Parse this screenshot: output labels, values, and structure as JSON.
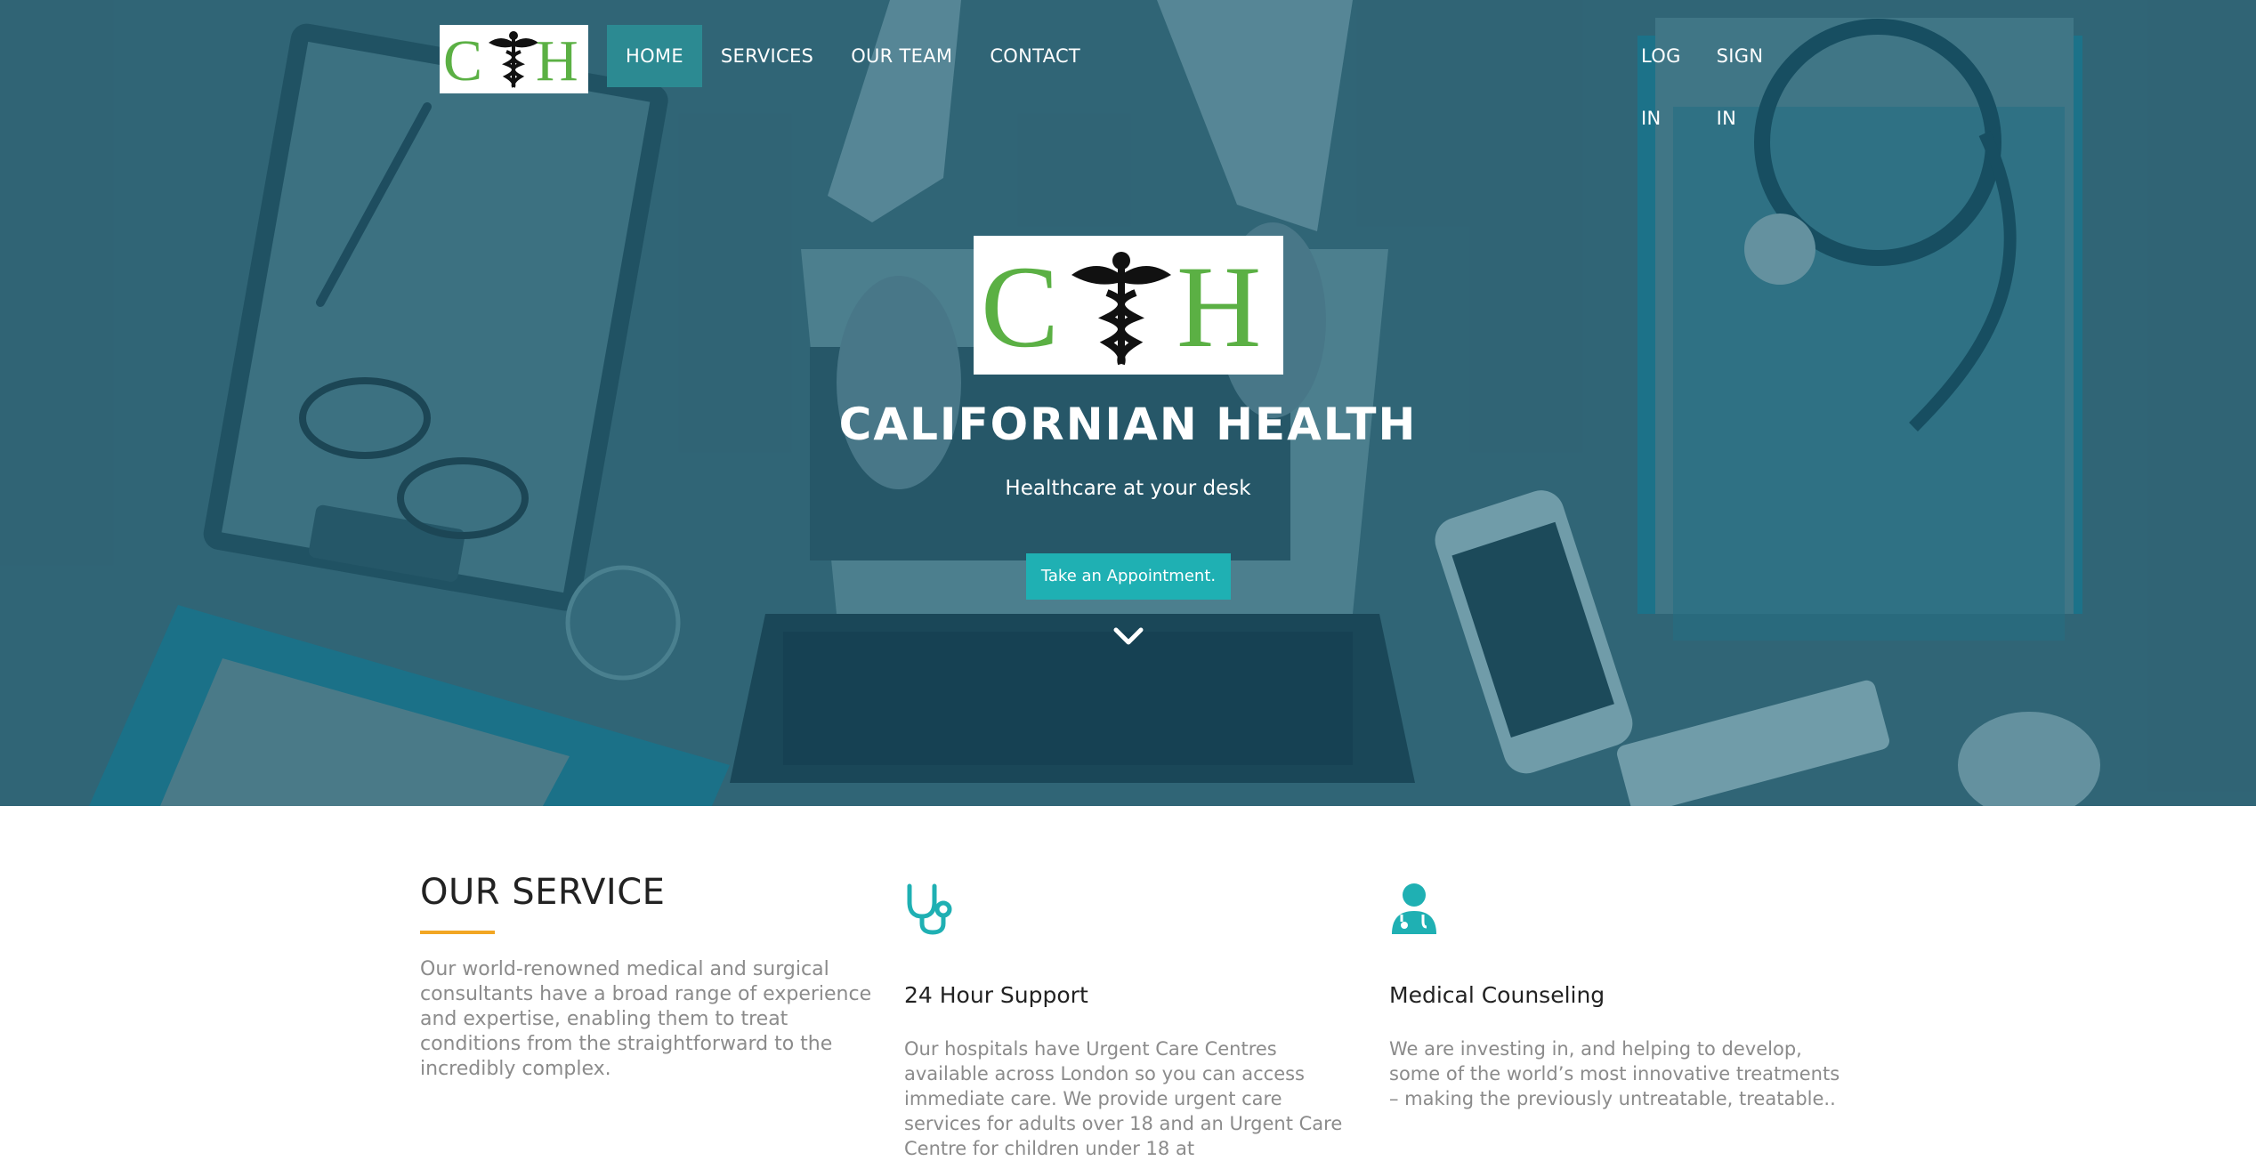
{
  "colors": {
    "accent": "#1fb0b3",
    "underline": "#f2a623",
    "nav_active": "#2c8a92",
    "logo_green": "#5bb044"
  },
  "nav": {
    "logo_letters": [
      "C",
      "H"
    ],
    "links": [
      "HOME",
      "SERVICES",
      "OUR TEAM",
      "CONTACT"
    ],
    "right_links": [
      "LOG IN",
      "SIGN IN"
    ]
  },
  "hero": {
    "logo_letters": [
      "C",
      "H"
    ],
    "title": "CALIFORNIAN HEALTH",
    "subtitle": "Healthcare at your desk",
    "button": "Take an Appointment.",
    "scroll_icon": "chevron-down-icon"
  },
  "services": {
    "title": "OUR SERVICE",
    "intro": "Our world-renowned medical and surgical consultants have a broad range of experience and expertise, enabling them to treat conditions from the straightforward to the incredibly complex.",
    "cards": [
      {
        "icon": "stethoscope-icon",
        "title": "24 Hour Support",
        "text": "Our hospitals have Urgent Care Centres available across London so you can access immediate care. We provide urgent care services for adults over 18 and an Urgent Care Centre for children under 18 at"
      },
      {
        "icon": "doctor-icon",
        "title": "Medical Counseling",
        "text": "We are investing in, and helping to develop, some of the world’s most innovative treatments – making the previously untreatable, treatable.."
      }
    ]
  }
}
